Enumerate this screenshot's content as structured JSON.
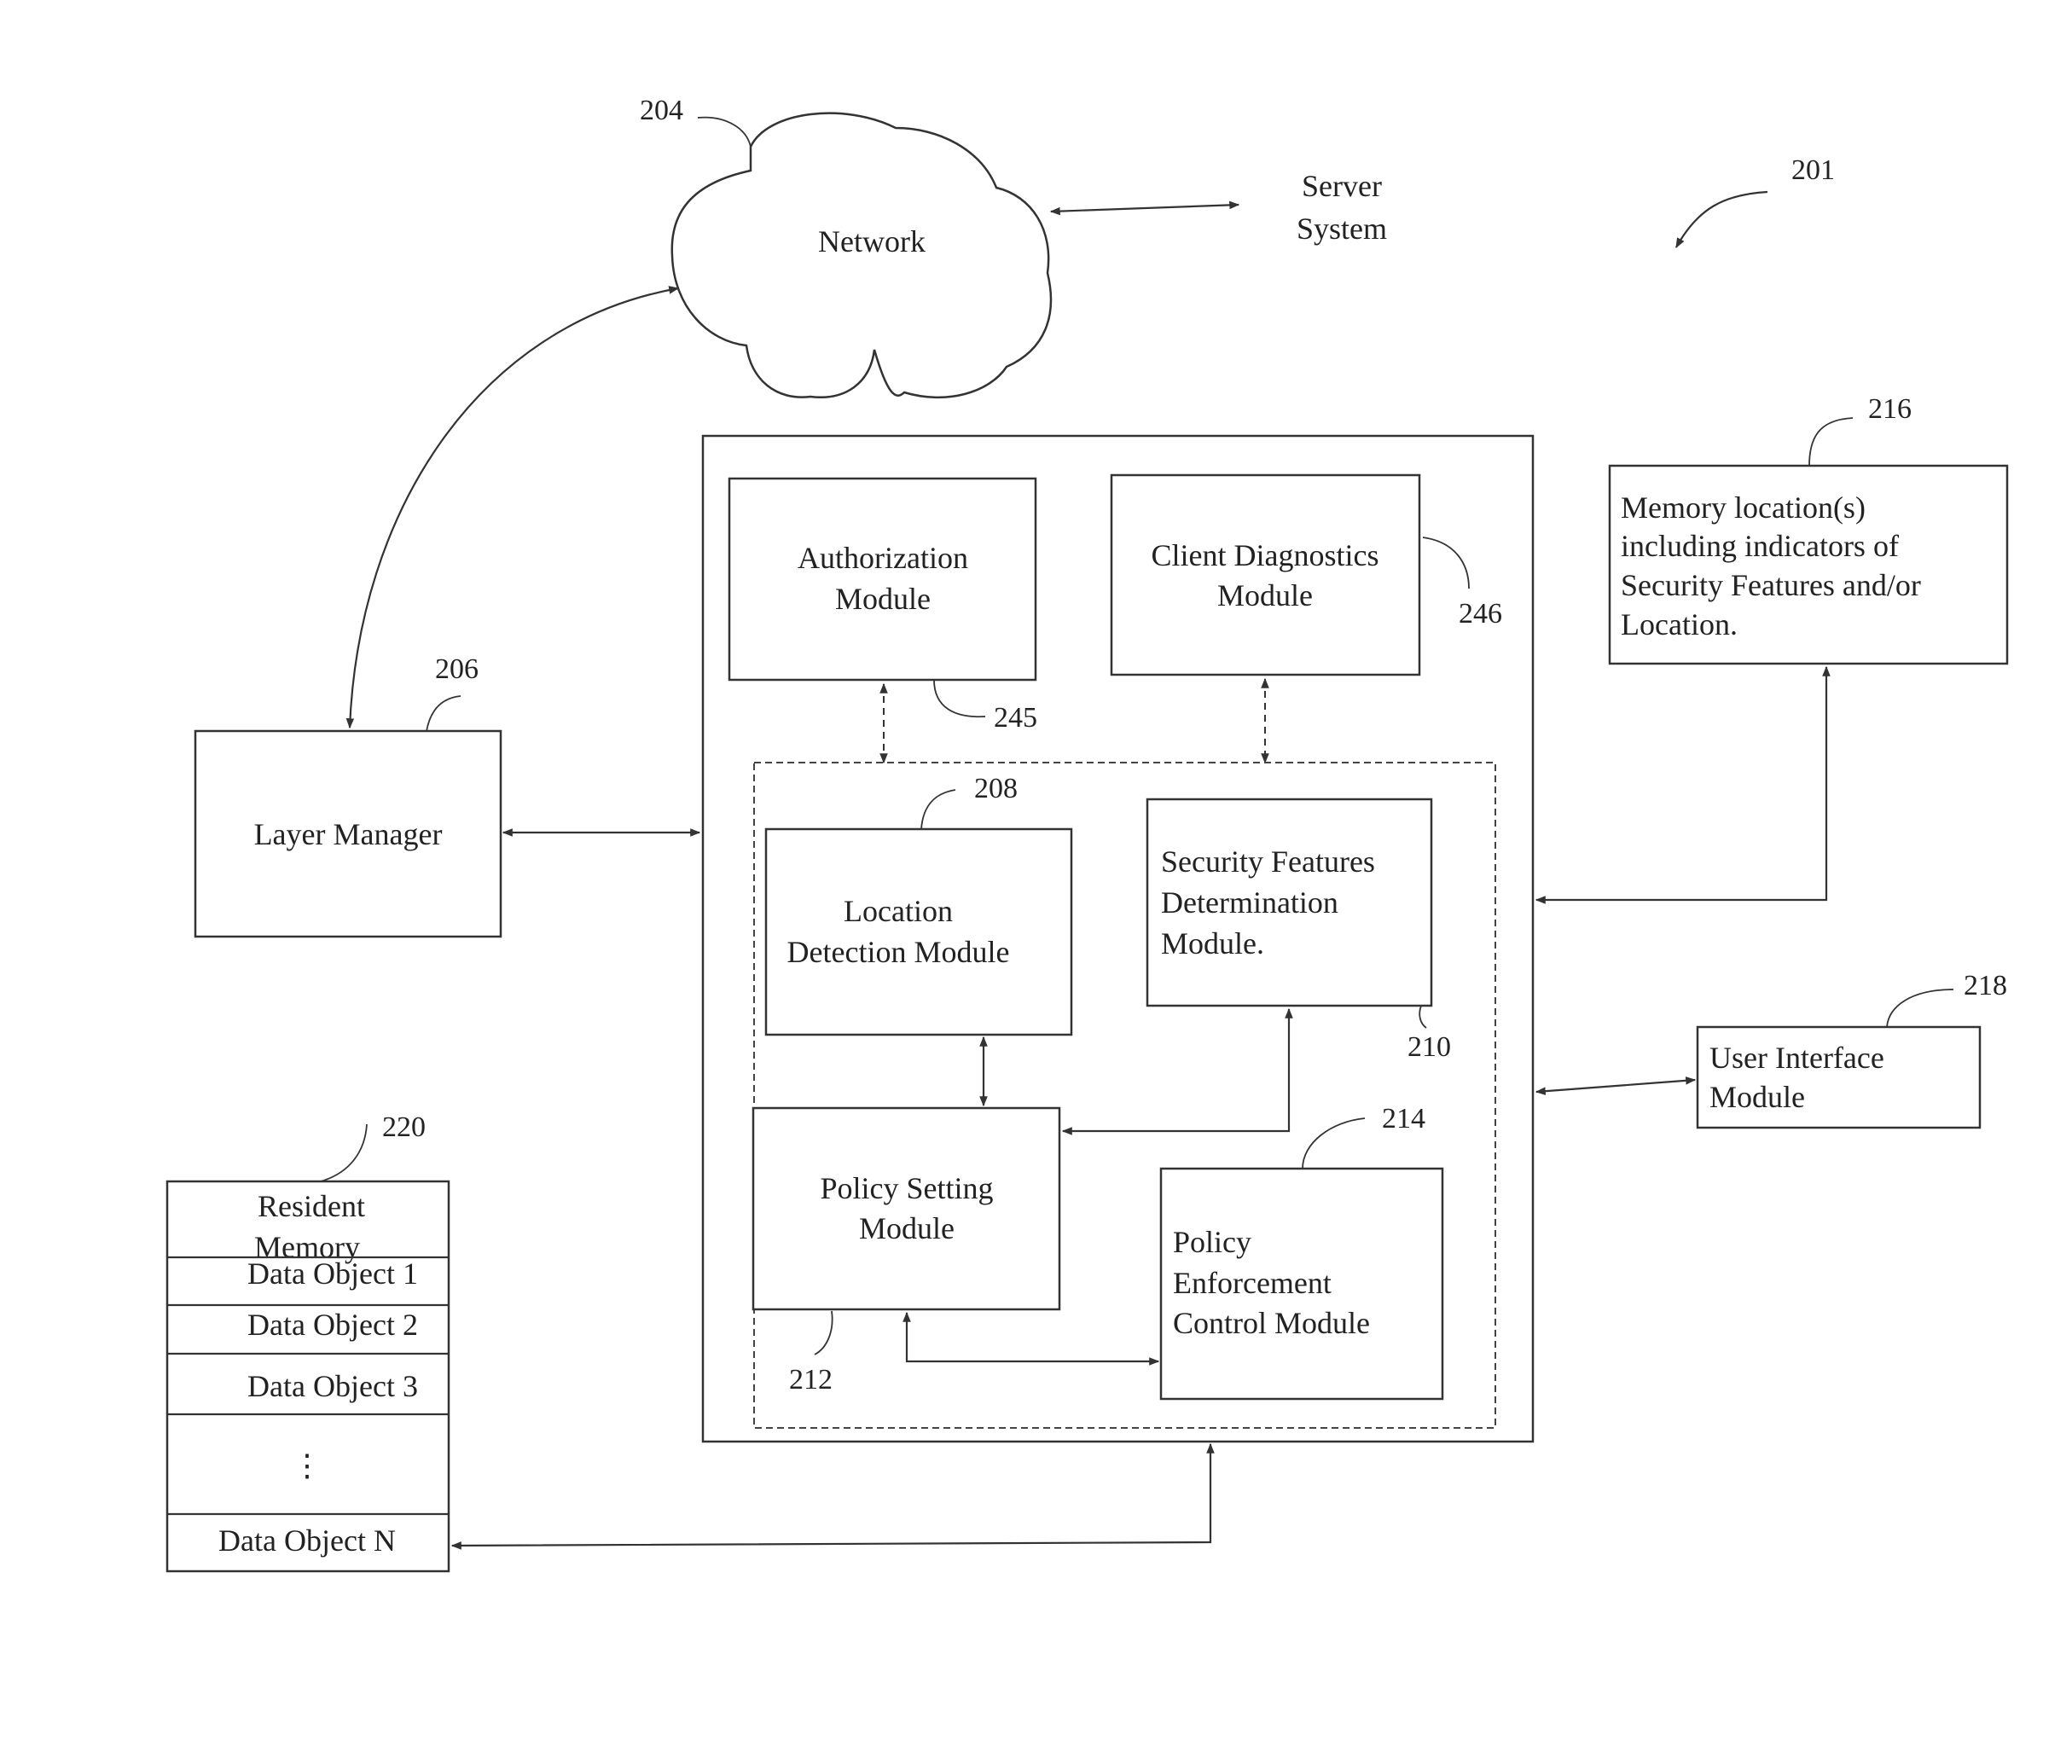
{
  "figure": {
    "ref_label": "201",
    "network": {
      "label": "Network",
      "ref": "204"
    },
    "server_system": {
      "lines": [
        "Server",
        "System"
      ]
    },
    "layer_manager": {
      "label": "Layer Manager",
      "ref": "206"
    },
    "authorization_module": {
      "lines": [
        "Authorization",
        "Module"
      ],
      "ref": "245"
    },
    "client_diagnostics_module": {
      "lines": [
        "Client Diagnostics",
        "Module"
      ],
      "ref": "246"
    },
    "location_detection_module": {
      "lines": [
        "Location",
        "Detection Module"
      ],
      "ref": "208"
    },
    "security_features_module": {
      "lines": [
        "Security Features",
        "Determination",
        "Module."
      ],
      "ref": "210"
    },
    "policy_setting_module": {
      "lines": [
        "Policy Setting",
        "Module"
      ],
      "ref": "212"
    },
    "policy_enforcement_module": {
      "lines": [
        "Policy",
        "Enforcement",
        "Control Module"
      ],
      "ref": "214"
    },
    "memory_locations": {
      "lines": [
        "Memory location(s)",
        "including indicators of",
        "Security Features and/or",
        "Location."
      ],
      "ref": "216"
    },
    "user_interface_module": {
      "lines": [
        "User Interface",
        "Module"
      ],
      "ref": "218"
    },
    "resident_memory": {
      "lines": [
        "Resident",
        "Memory"
      ],
      "ref": "220",
      "rows": [
        "Data Object 1",
        "Data Object 2",
        "Data Object 3",
        "⋮",
        "Data Object N"
      ]
    }
  }
}
